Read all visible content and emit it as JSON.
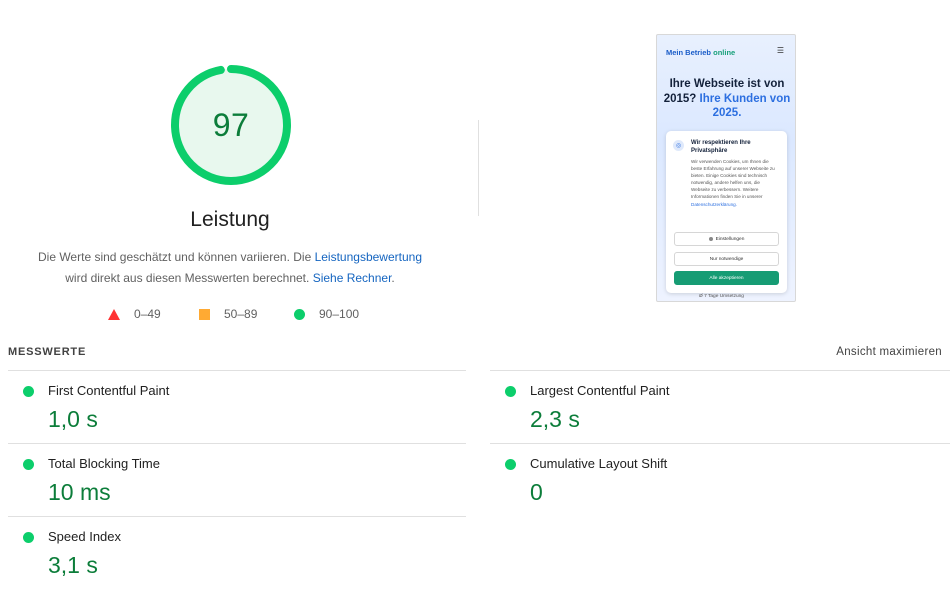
{
  "gauge": {
    "score": "97",
    "score_fraction": 0.97,
    "title": "Leistung",
    "color": "#0cce6b",
    "desc_part1": "Die Werte sind geschätzt und können variieren. Die ",
    "desc_link1": "Leistungsbewertung",
    "desc_part2": " wird direkt aus diesen Messwerten berechnet. ",
    "desc_link2": "Siehe Rechner",
    "desc_part3": "."
  },
  "legend": [
    {
      "range": "0–49",
      "shape": "triangle",
      "color": "#ff3333"
    },
    {
      "range": "50–89",
      "shape": "square",
      "color": "#ffaa33"
    },
    {
      "range": "90–100",
      "shape": "circle",
      "color": "#0cce6b"
    }
  ],
  "screenshot": {
    "brand": "Mein Betrieb",
    "brand_accent": "online",
    "menu_icon": "hamburger-icon",
    "hero_part1": "Ihre Webseite ist von 2015?",
    "hero_part2": "Ihre Kunden von 2025.",
    "cookie_title": "Wir respektieren Ihre Privatsphäre",
    "cookie_text": "Wir verwenden Cookies, um Ihnen die beste Erfahrung auf unserer Webseite zu bieten. Einige Cookies sind technisch notwendig, andere helfen uns, die Webseite zu verbessern. Weitere Informationen finden Sie in unserer",
    "cookie_link": "Datenschutzerklärung.",
    "btn_settings": "Einstellungen",
    "btn_necessary": "Nur notwendige",
    "btn_accept": "Alle akzeptieren",
    "footer": "Ø 7 Tage Umsetzung"
  },
  "metrics": {
    "header": "MESSWERTE",
    "toggle": "Ansicht maximieren",
    "items": [
      {
        "label": "First Contentful Paint",
        "value": "1,0 s"
      },
      {
        "label": "Largest Contentful Paint",
        "value": "2,3 s"
      },
      {
        "label": "Total Blocking Time",
        "value": "10 ms"
      },
      {
        "label": "Cumulative Layout Shift",
        "value": "0"
      },
      {
        "label": "Speed Index",
        "value": "3,1 s"
      }
    ]
  }
}
